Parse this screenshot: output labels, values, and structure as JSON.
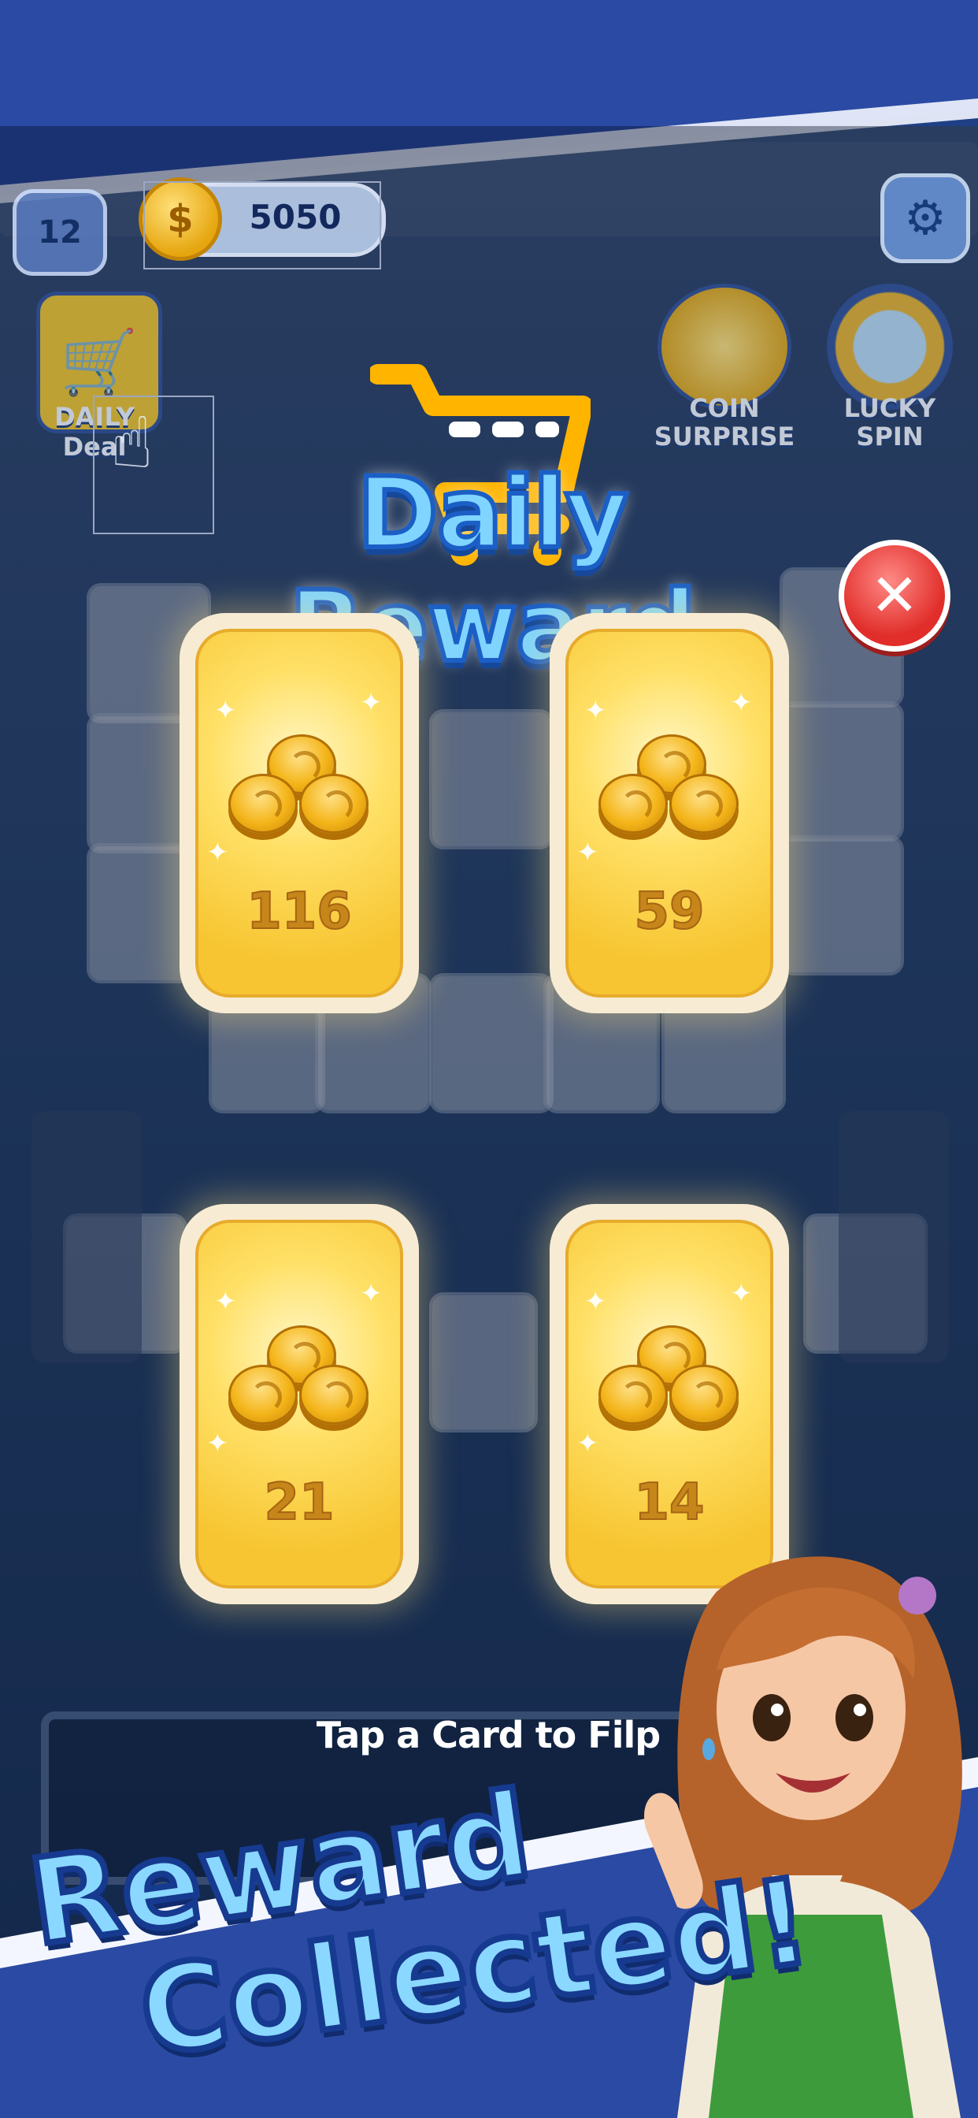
{
  "hud": {
    "level": "12",
    "coins": "5050",
    "coin_icon": "$",
    "settings_icon": "gear-icon"
  },
  "side_buttons": {
    "daily_deal": "DAILY Deal",
    "coin_surprise": "COIN SURPRISE",
    "lucky_spin": "LUCKY SPIN"
  },
  "title": "Daily Reward",
  "close_icon": "✕",
  "cards": [
    {
      "amount": "116"
    },
    {
      "amount": "59"
    },
    {
      "amount": "21"
    },
    {
      "amount": "14"
    }
  ],
  "hint": "Tap a Card to Filp",
  "banner": {
    "line1": "Reward",
    "line2": "Collected!"
  },
  "colors": {
    "banner_blue": "#2b4aa3",
    "card_gold": "#ffe066",
    "close_red": "#e12e2a"
  }
}
